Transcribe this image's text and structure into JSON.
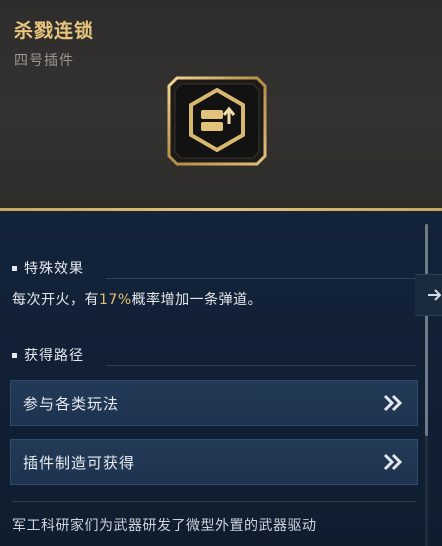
{
  "header": {
    "title": "杀戮连锁",
    "subtitle": "四号插件"
  },
  "sections": {
    "effect_title": "特殊效果",
    "effect_parts": [
      "每次开火，有",
      "17%",
      "概率增加一条弹道。"
    ],
    "route_title": "获得路径"
  },
  "routes": [
    {
      "label": "参与各类玩法"
    },
    {
      "label": "插件制造可获得"
    }
  ],
  "footer": {
    "description": "军工科研家们为武器研发了微型外置的武器驱动"
  },
  "icons": {
    "item": "plugin-emblem-icon",
    "arrow": "double-chevron-right-icon",
    "side": "arrow-right-icon"
  },
  "colors": {
    "accent": "#e7c57d",
    "highlight": "#e4bf6c",
    "panel": "#0f1c2b"
  }
}
